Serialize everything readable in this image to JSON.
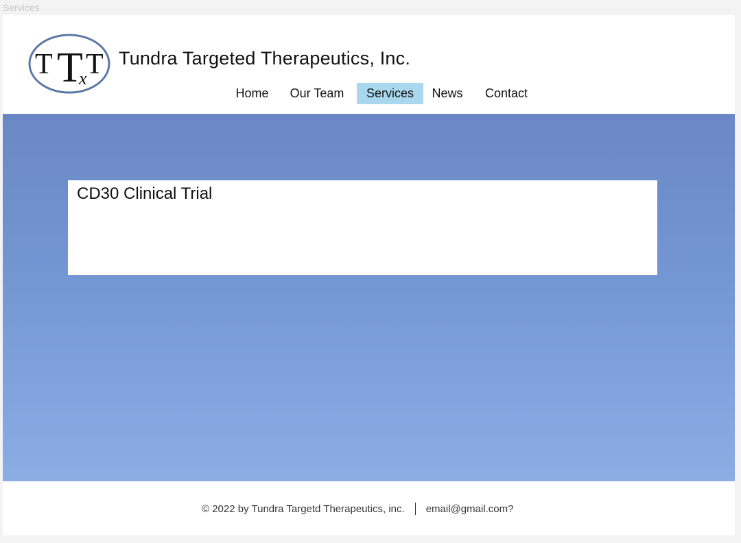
{
  "page": {
    "label": "Services"
  },
  "header": {
    "logo": {
      "letters": [
        "T",
        "T",
        "T"
      ],
      "subscript": "x",
      "ring_color": "#5b76a8"
    },
    "title": "Tundra Targeted Therapeutics, Inc."
  },
  "nav": {
    "items": [
      {
        "label": "Home",
        "active": false
      },
      {
        "label": "Our Team",
        "active": false
      },
      {
        "label": "Services",
        "active": true
      },
      {
        "label": "News",
        "active": false
      },
      {
        "label": "Contact",
        "active": false
      }
    ],
    "active_color": "#a9d8ee"
  },
  "main": {
    "card_title": "CD30 Clinical Trial",
    "background_color": "#7496d3"
  },
  "footer": {
    "copyright": "© 2022 by Tundra Targetd Therapeutics, inc.",
    "email": "email@gmail.com?"
  }
}
